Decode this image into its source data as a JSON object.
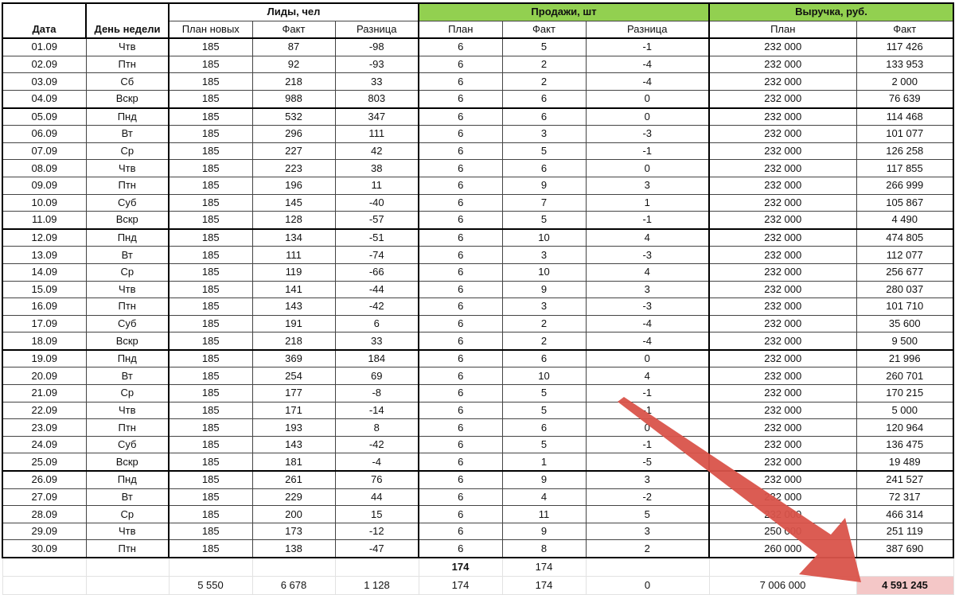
{
  "headers": {
    "date": "Дата",
    "weekday": "День недели",
    "leads": "Лиды, чел",
    "sales": "Продажи, шт",
    "revenue": "Выручка, руб.",
    "sub": [
      "План новых",
      "Факт",
      "Разница",
      "План",
      "Факт",
      "Разница",
      "План",
      "Факт"
    ]
  },
  "rows": [
    [
      "01.09",
      "Чтв",
      "185",
      "87",
      "-98",
      "6",
      "5",
      "-1",
      "232 000",
      "117 426"
    ],
    [
      "02.09",
      "Птн",
      "185",
      "92",
      "-93",
      "6",
      "2",
      "-4",
      "232 000",
      "133 953"
    ],
    [
      "03.09",
      "Сб",
      "185",
      "218",
      "33",
      "6",
      "2",
      "-4",
      "232 000",
      "2 000"
    ],
    [
      "04.09",
      "Вскр",
      "185",
      "988",
      "803",
      "6",
      "6",
      "0",
      "232 000",
      "76 639"
    ],
    [
      "05.09",
      "Пнд",
      "185",
      "532",
      "347",
      "6",
      "6",
      "0",
      "232 000",
      "114 468"
    ],
    [
      "06.09",
      "Вт",
      "185",
      "296",
      "111",
      "6",
      "3",
      "-3",
      "232 000",
      "101 077"
    ],
    [
      "07.09",
      "Ср",
      "185",
      "227",
      "42",
      "6",
      "5",
      "-1",
      "232 000",
      "126 258"
    ],
    [
      "08.09",
      "Чтв",
      "185",
      "223",
      "38",
      "6",
      "6",
      "0",
      "232 000",
      "117 855"
    ],
    [
      "09.09",
      "Птн",
      "185",
      "196",
      "11",
      "6",
      "9",
      "3",
      "232 000",
      "266 999"
    ],
    [
      "10.09",
      "Суб",
      "185",
      "145",
      "-40",
      "6",
      "7",
      "1",
      "232 000",
      "105 867"
    ],
    [
      "11.09",
      "Вскр",
      "185",
      "128",
      "-57",
      "6",
      "5",
      "-1",
      "232 000",
      "4 490"
    ],
    [
      "12.09",
      "Пнд",
      "185",
      "134",
      "-51",
      "6",
      "10",
      "4",
      "232 000",
      "474 805"
    ],
    [
      "13.09",
      "Вт",
      "185",
      "111",
      "-74",
      "6",
      "3",
      "-3",
      "232 000",
      "112 077"
    ],
    [
      "14.09",
      "Ср",
      "185",
      "119",
      "-66",
      "6",
      "10",
      "4",
      "232 000",
      "256 677"
    ],
    [
      "15.09",
      "Чтв",
      "185",
      "141",
      "-44",
      "6",
      "9",
      "3",
      "232 000",
      "280 037"
    ],
    [
      "16.09",
      "Птн",
      "185",
      "143",
      "-42",
      "6",
      "3",
      "-3",
      "232 000",
      "101 710"
    ],
    [
      "17.09",
      "Суб",
      "185",
      "191",
      "6",
      "6",
      "2",
      "-4",
      "232 000",
      "35 600"
    ],
    [
      "18.09",
      "Вскр",
      "185",
      "218",
      "33",
      "6",
      "2",
      "-4",
      "232 000",
      "9 500"
    ],
    [
      "19.09",
      "Пнд",
      "185",
      "369",
      "184",
      "6",
      "6",
      "0",
      "232 000",
      "21 996"
    ],
    [
      "20.09",
      "Вт",
      "185",
      "254",
      "69",
      "6",
      "10",
      "4",
      "232 000",
      "260 701"
    ],
    [
      "21.09",
      "Ср",
      "185",
      "177",
      "-8",
      "6",
      "5",
      "-1",
      "232 000",
      "170 215"
    ],
    [
      "22.09",
      "Чтв",
      "185",
      "171",
      "-14",
      "6",
      "5",
      "-1",
      "232 000",
      "5 000"
    ],
    [
      "23.09",
      "Птн",
      "185",
      "193",
      "8",
      "6",
      "6",
      "0",
      "232 000",
      "120 964"
    ],
    [
      "24.09",
      "Суб",
      "185",
      "143",
      "-42",
      "6",
      "5",
      "-1",
      "232 000",
      "136 475"
    ],
    [
      "25.09",
      "Вскр",
      "185",
      "181",
      "-4",
      "6",
      "1",
      "-5",
      "232 000",
      "19 489"
    ],
    [
      "26.09",
      "Пнд",
      "185",
      "261",
      "76",
      "6",
      "9",
      "3",
      "232 000",
      "241 527"
    ],
    [
      "27.09",
      "Вт",
      "185",
      "229",
      "44",
      "6",
      "4",
      "-2",
      "232 000",
      "72 317"
    ],
    [
      "28.09",
      "Ср",
      "185",
      "200",
      "15",
      "6",
      "11",
      "5",
      "232 000",
      "466 314"
    ],
    [
      "29.09",
      "Чтв",
      "185",
      "173",
      "-12",
      "6",
      "9",
      "3",
      "250 000",
      "251 119"
    ],
    [
      "30.09",
      "Птн",
      "185",
      "138",
      "-47",
      "6",
      "8",
      "2",
      "260 000",
      "387 690"
    ]
  ],
  "totals1": {
    "sales_plan": "174",
    "sales_fact": "174"
  },
  "totals2": {
    "leads_plan": "5 550",
    "leads_fact": "6 678",
    "leads_diff": "1 128",
    "sales_plan": "174",
    "sales_fact": "174",
    "sales_diff": "0",
    "rev_plan": "7 006 000",
    "rev_fact": "4 591 245"
  },
  "colors": {
    "header_green": "#92d050",
    "highlight": "#f4c7c7",
    "arrow": "#d9534a"
  }
}
